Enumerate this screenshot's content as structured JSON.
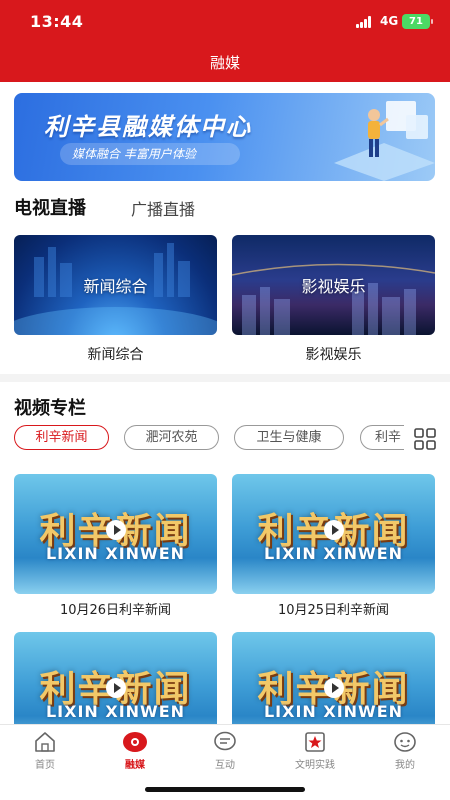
{
  "status_bar": {
    "time": "13:44",
    "network": "4G",
    "battery": "71"
  },
  "header": {
    "title": "融媒"
  },
  "banner": {
    "title": "利辛县融媒体中心",
    "subtitle": "媒体融合  丰富用户体验"
  },
  "live_section": {
    "tabs": [
      "电视直播",
      "广播直播"
    ],
    "channels": [
      {
        "thumb_label": "新闻综合",
        "name": "新闻综合"
      },
      {
        "thumb_label": "影视娱乐",
        "name": "影视娱乐"
      }
    ]
  },
  "video_section": {
    "title": "视频专栏",
    "chips": [
      "利辛新闻",
      "淝河农苑",
      "卫生与健康",
      "利辛"
    ],
    "selected_chip": "利辛新闻",
    "thumb_title_cn": "利辛新闻",
    "thumb_title_en": "LIXIN XINWEN",
    "videos": [
      {
        "title": "10月26日利辛新闻"
      },
      {
        "title": "10月25日利辛新闻"
      },
      {
        "title": ""
      },
      {
        "title": ""
      }
    ]
  },
  "tab_bar": {
    "items": [
      {
        "label": "首页",
        "icon": "home-icon"
      },
      {
        "label": "融媒",
        "icon": "media-icon"
      },
      {
        "label": "互动",
        "icon": "chat-icon"
      },
      {
        "label": "文明实践",
        "icon": "civilization-icon"
      },
      {
        "label": "我的",
        "icon": "profile-icon"
      }
    ],
    "active": "融媒"
  },
  "colors": {
    "brand_red": "#d8181c",
    "banner_blue": "#2c6ee0",
    "chip_border": "#999999"
  }
}
